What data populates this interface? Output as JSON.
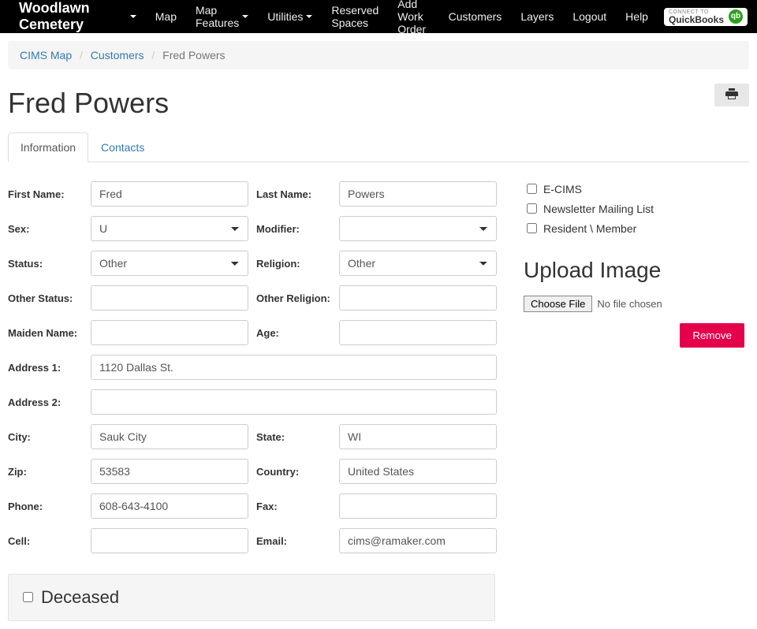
{
  "nav": {
    "brand": "Woodlawn Cemetery",
    "items": [
      "Map",
      "Map Features",
      "Utilities",
      "Reserved Spaces",
      "Add Work Order",
      "Customers",
      "Layers"
    ],
    "right": [
      "Logout",
      "Help"
    ],
    "quickbooks_top": "CONNECT TO",
    "quickbooks_main": "QuickBooks"
  },
  "breadcrumb": {
    "items": [
      "CIMS Map",
      "Customers",
      "Fred Powers"
    ]
  },
  "page_title": "Fred Powers",
  "tabs": {
    "information": "Information",
    "contacts": "Contacts"
  },
  "form": {
    "labels": {
      "first_name": "First Name:",
      "last_name": "Last Name:",
      "sex": "Sex:",
      "modifier": "Modifier:",
      "status": "Status:",
      "religion": "Religion:",
      "other_status": "Other Status:",
      "other_religion": "Other Religion:",
      "maiden_name": "Maiden Name:",
      "age": "Age:",
      "address1": "Address 1:",
      "address2": "Address 2:",
      "city": "City:",
      "state": "State:",
      "zip": "Zip:",
      "country": "Country:",
      "phone": "Phone:",
      "fax": "Fax:",
      "cell": "Cell:",
      "email": "Email:"
    },
    "values": {
      "first_name": "Fred",
      "last_name": "Powers",
      "sex": "U",
      "modifier": "",
      "status": "Other",
      "religion": "Other",
      "other_status": "",
      "other_religion": "",
      "maiden_name": "",
      "age": "",
      "address1": "1120 Dallas St.",
      "address2": "",
      "city": "Sauk City",
      "state": "WI",
      "zip": "53583",
      "country": "United States",
      "phone": "608-643-4100",
      "fax": "",
      "cell": "",
      "email": "cims@ramaker.com"
    }
  },
  "checkboxes": {
    "ecims": "E-CIMS",
    "newsletter": "Newsletter Mailing List",
    "resident": "Resident \\ Member"
  },
  "upload": {
    "title": "Upload Image",
    "choose": "Choose File",
    "nofile": "No file chosen",
    "remove": "Remove"
  },
  "deceased": {
    "label": "Deceased"
  }
}
